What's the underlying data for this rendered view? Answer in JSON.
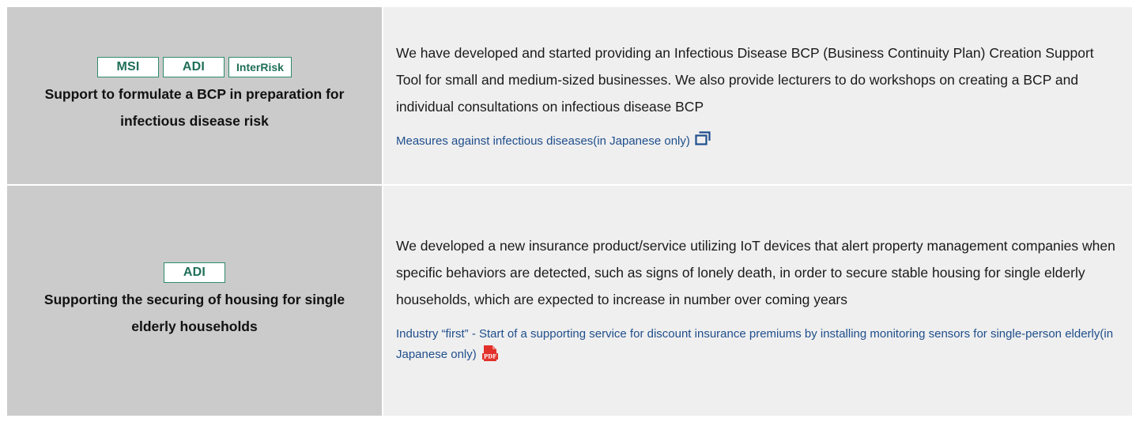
{
  "rows": [
    {
      "badges": [
        "MSI",
        "ADI",
        "InterRisk"
      ],
      "title": "Support to formulate a BCP in preparation for infectious disease risk",
      "description": "We have developed and started providing an Infectious Disease BCP (Business Continuity Plan) Creation Support Tool for small and medium-sized businesses. We also provide lecturers to do workshops on creating a BCP and individual consultations on infectious disease BCP",
      "link_text": "Measures against infectious diseases(in Japanese only)",
      "link_icon": "external-window-icon"
    },
    {
      "badges": [
        "ADI"
      ],
      "title": "Supporting the securing of housing for single elderly households",
      "description": "We developed a new insurance product/service utilizing IoT devices that alert property management companies when specific behaviors are detected, such as signs of lonely death, in order to secure stable housing for single elderly households, which are expected to increase in number over coming years",
      "link_text": "Industry “first” - Start of a supporting service for discount insurance premiums by installing monitoring sensors for single-person elderly(in Japanese only)",
      "link_icon": "pdf-icon",
      "pdf_label": "PDF"
    }
  ],
  "colors": {
    "left_cell_bg": "#cbcbcb",
    "right_cell_bg": "#efefef",
    "badge_border": "#2e8a6e",
    "badge_text": "#1f6f58",
    "link": "#1f4e8c",
    "pdf_red": "#e2312b"
  }
}
